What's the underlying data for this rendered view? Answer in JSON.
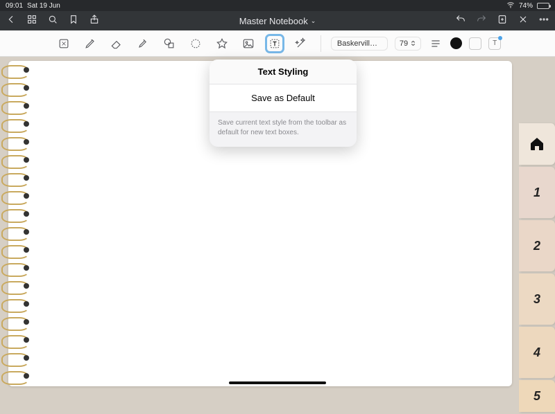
{
  "status": {
    "time": "09:01",
    "date": "Sat 19 Jun",
    "battery_pct": "74%"
  },
  "nav": {
    "title": "Master Notebook"
  },
  "toolbar": {
    "font_name": "Baskerville-B...",
    "font_size": "79",
    "text_glyph": "T"
  },
  "popover": {
    "title": "Text Styling",
    "save_label": "Save as Default",
    "desc": "Save current text style from the toolbar as default for new text boxes."
  },
  "tabs": {
    "t1": "1",
    "t2": "2",
    "t3": "3",
    "t4": "4",
    "t5": "5"
  }
}
